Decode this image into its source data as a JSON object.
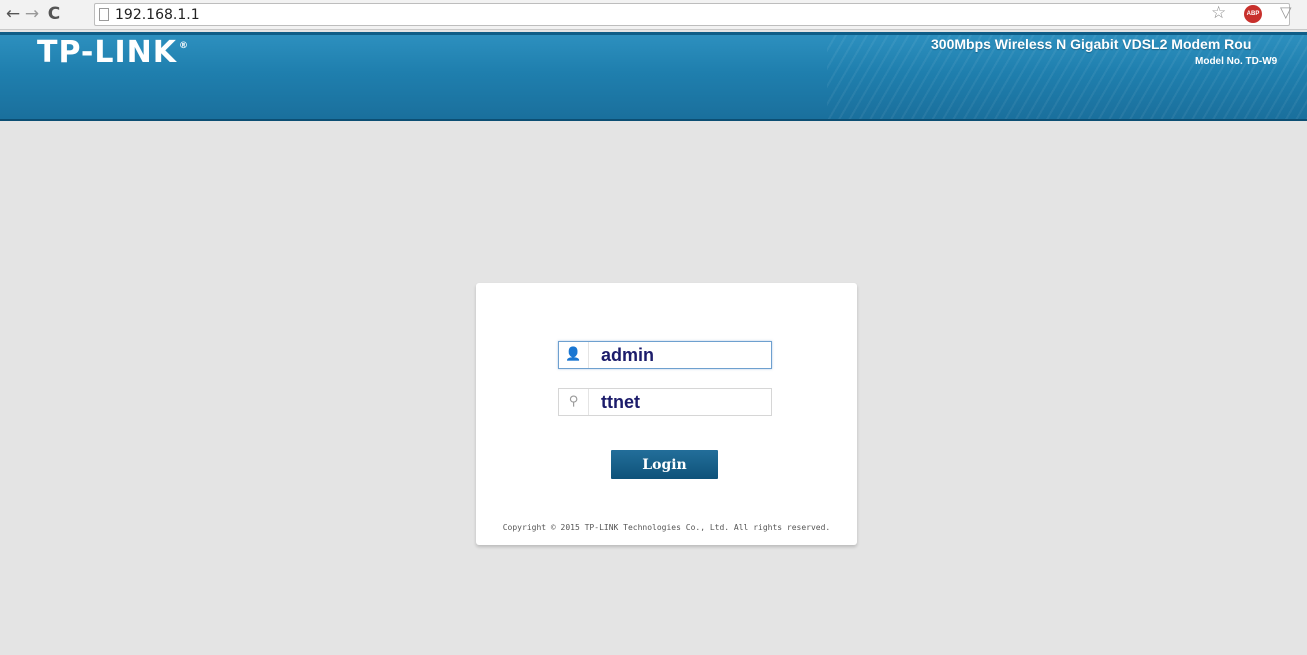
{
  "browser": {
    "back_icon": "←",
    "forward_icon": "→",
    "reload_icon": "C",
    "url": "192.168.1.1",
    "star_icon": "☆",
    "abp_label": "ABP",
    "shield_icon": "▽"
  },
  "header": {
    "logo": "TP-LINK",
    "logo_mark": "®",
    "product_name": "300Mbps Wireless N Gigabit VDSL2 Modem Rou",
    "model_no": "Model No. TD-W9",
    "colors": {
      "header_blue": "#1f7fae",
      "button_blue": "#0e5279"
    }
  },
  "login": {
    "username_icon": "👤",
    "username_value": "admin",
    "password_icon": "⚲",
    "password_value": "ttnet",
    "button_label": "Login",
    "copyright": "Copyright © 2015 TP-LINK Technologies Co., Ltd. All rights reserved."
  }
}
